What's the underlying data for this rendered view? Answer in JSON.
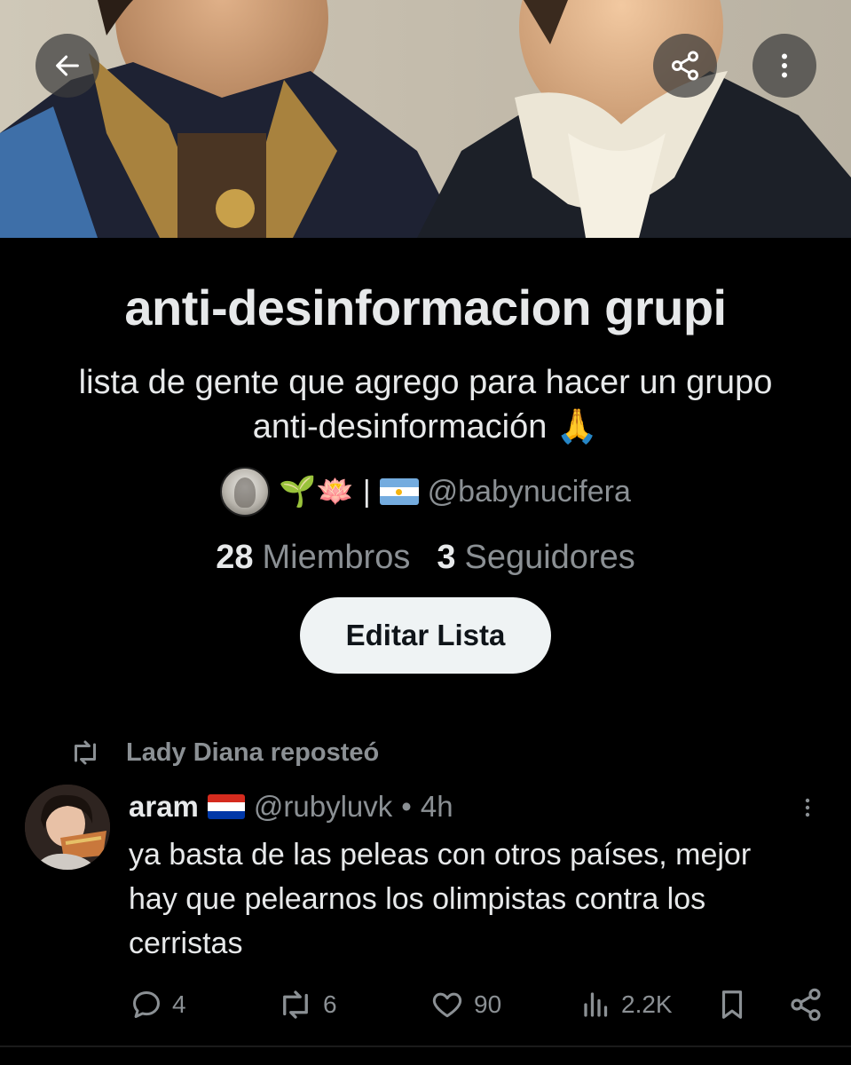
{
  "header": {
    "back_icon": "arrow-left-icon",
    "share_icon": "share-icon",
    "more_icon": "more-vertical-icon"
  },
  "list": {
    "title": "anti-desinformacion grupi",
    "description": "lista de gente que agrego para hacer un grupo anti-desinformación 🙏",
    "owner": {
      "emojis": "🌱🪷",
      "separator": "|",
      "handle": "@babynucifera"
    },
    "stats": {
      "members_count": "28",
      "members_label": "Miembros",
      "followers_count": "3",
      "followers_label": "Seguidores"
    },
    "edit_button_label": "Editar Lista"
  },
  "tweet": {
    "repost_label": "Lady Diana reposteó",
    "author_name": "aram",
    "author_handle": "@rubyluvk",
    "separator": "•",
    "time": "4h",
    "text": "ya basta de las peleas con otros países, mejor hay que pelearnos los olimpistas contra los cerristas",
    "replies": "4",
    "reposts": "6",
    "likes": "90",
    "views": "2.2K"
  },
  "colors": {
    "background": "#000000",
    "text_primary": "#e7e9ea",
    "text_secondary": "#8b9094",
    "button_bg": "#eff3f4"
  }
}
